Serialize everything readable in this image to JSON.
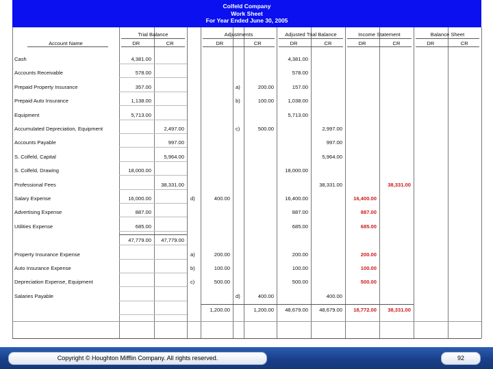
{
  "header": {
    "company": "Colfeld Company",
    "title": "Work Sheet",
    "period": "For Year Ended June 30, 2005"
  },
  "columns": {
    "account_name": "Account Name",
    "groups": [
      "Trial Balance",
      "Adjustments",
      "Adjusted Trial Balance",
      "Income Statement",
      "Balance Sheet"
    ],
    "dr": "DR",
    "cr": "CR"
  },
  "rows": [
    {
      "name": "Cash",
      "tb_dr": "4,381.00",
      "tb_cr": "",
      "adj_dr_ref": "",
      "adj_dr": "",
      "adj_cr_ref": "",
      "adj_cr": "",
      "atb_dr": "4,381.00",
      "atb_cr": "",
      "is_dr": "",
      "is_cr": ""
    },
    {
      "name": "Accounts Receivable",
      "tb_dr": "578.00",
      "tb_cr": "",
      "adj_dr_ref": "",
      "adj_dr": "",
      "adj_cr_ref": "",
      "adj_cr": "",
      "atb_dr": "578.00",
      "atb_cr": "",
      "is_dr": "",
      "is_cr": ""
    },
    {
      "name": "Prepaid Property Insurance",
      "tb_dr": "357.00",
      "tb_cr": "",
      "adj_dr_ref": "",
      "adj_dr": "",
      "adj_cr_ref": "a)",
      "adj_cr": "200.00",
      "atb_dr": "157.00",
      "atb_cr": "",
      "is_dr": "",
      "is_cr": ""
    },
    {
      "name": "Prepaid Auto Insurance",
      "tb_dr": "1,138.00",
      "tb_cr": "",
      "adj_dr_ref": "",
      "adj_dr": "",
      "adj_cr_ref": "b)",
      "adj_cr": "100.00",
      "atb_dr": "1,038.00",
      "atb_cr": "",
      "is_dr": "",
      "is_cr": ""
    },
    {
      "name": "Equipment",
      "tb_dr": "5,713.00",
      "tb_cr": "",
      "adj_dr_ref": "",
      "adj_dr": "",
      "adj_cr_ref": "",
      "adj_cr": "",
      "atb_dr": "5,713.00",
      "atb_cr": "",
      "is_dr": "",
      "is_cr": ""
    },
    {
      "name": "Accumulated Depreciation, Equipment",
      "tb_dr": "",
      "tb_cr": "2,497.00",
      "adj_dr_ref": "",
      "adj_dr": "",
      "adj_cr_ref": "c)",
      "adj_cr": "500.00",
      "atb_dr": "",
      "atb_cr": "2,997.00",
      "is_dr": "",
      "is_cr": ""
    },
    {
      "name": "Accounts Payable",
      "tb_dr": "",
      "tb_cr": "997.00",
      "adj_dr_ref": "",
      "adj_dr": "",
      "adj_cr_ref": "",
      "adj_cr": "",
      "atb_dr": "",
      "atb_cr": "997.00",
      "is_dr": "",
      "is_cr": ""
    },
    {
      "name": "S. Colfeld, Capital",
      "tb_dr": "",
      "tb_cr": "5,964.00",
      "adj_dr_ref": "",
      "adj_dr": "",
      "adj_cr_ref": "",
      "adj_cr": "",
      "atb_dr": "",
      "atb_cr": "5,964.00",
      "is_dr": "",
      "is_cr": ""
    },
    {
      "name": "S. Colfeld, Drawing",
      "tb_dr": "18,000.00",
      "tb_cr": "",
      "adj_dr_ref": "",
      "adj_dr": "",
      "adj_cr_ref": "",
      "adj_cr": "",
      "atb_dr": "18,000.00",
      "atb_cr": "",
      "is_dr": "",
      "is_cr": ""
    },
    {
      "name": "Professional Fees",
      "tb_dr": "",
      "tb_cr": "38,331.00",
      "adj_dr_ref": "",
      "adj_dr": "",
      "adj_cr_ref": "",
      "adj_cr": "",
      "atb_dr": "",
      "atb_cr": "38,331.00",
      "is_dr": "",
      "is_cr": "38,331.00"
    },
    {
      "name": "Salary Expense",
      "tb_dr": "16,000.00",
      "tb_cr": "",
      "adj_dr_ref": "d)",
      "adj_dr": "400.00",
      "adj_cr_ref": "",
      "adj_cr": "",
      "atb_dr": "16,400.00",
      "atb_cr": "",
      "is_dr": "16,400.00",
      "is_cr": ""
    },
    {
      "name": "Advertising Expense",
      "tb_dr": "887.00",
      "tb_cr": "",
      "adj_dr_ref": "",
      "adj_dr": "",
      "adj_cr_ref": "",
      "adj_cr": "",
      "atb_dr": "887.00",
      "atb_cr": "",
      "is_dr": "887.00",
      "is_cr": ""
    },
    {
      "name": "Utilities Expense",
      "tb_dr": "685.00",
      "tb_cr": "",
      "adj_dr_ref": "",
      "adj_dr": "",
      "adj_cr_ref": "",
      "adj_cr": "",
      "atb_dr": "685.00",
      "atb_cr": "",
      "is_dr": "685.00",
      "is_cr": ""
    },
    {
      "name": "",
      "tb_dr": "47,779.00",
      "tb_cr": "47,779.00",
      "adj_dr_ref": "",
      "adj_dr": "",
      "adj_cr_ref": "",
      "adj_cr": "",
      "atb_dr": "",
      "atb_cr": "",
      "is_dr": "",
      "is_cr": ""
    },
    {
      "name": "Property Insurance Expense",
      "tb_dr": "",
      "tb_cr": "",
      "adj_dr_ref": "a)",
      "adj_dr": "200.00",
      "adj_cr_ref": "",
      "adj_cr": "",
      "atb_dr": "200.00",
      "atb_cr": "",
      "is_dr": "200.00",
      "is_cr": ""
    },
    {
      "name": "Auto Insurance Expense",
      "tb_dr": "",
      "tb_cr": "",
      "adj_dr_ref": "b)",
      "adj_dr": "100.00",
      "adj_cr_ref": "",
      "adj_cr": "",
      "atb_dr": "100.00",
      "atb_cr": "",
      "is_dr": "100.00",
      "is_cr": ""
    },
    {
      "name": "Depreciation Expense, Equipment",
      "tb_dr": "",
      "tb_cr": "",
      "adj_dr_ref": "c)",
      "adj_dr": "500.00",
      "adj_cr_ref": "",
      "adj_cr": "",
      "atb_dr": "500.00",
      "atb_cr": "",
      "is_dr": "500.00",
      "is_cr": ""
    },
    {
      "name": "Salaries Payable",
      "tb_dr": "",
      "tb_cr": "",
      "adj_dr_ref": "",
      "adj_dr": "",
      "adj_cr_ref": "d)",
      "adj_cr": "400.00",
      "atb_dr": "",
      "atb_cr": "400.00",
      "is_dr": "",
      "is_cr": ""
    },
    {
      "name": "",
      "tb_dr": "",
      "tb_cr": "",
      "adj_dr_ref": "",
      "adj_dr": "1,200.00",
      "adj_cr_ref": "",
      "adj_cr": "1,200.00",
      "atb_dr": "48,679.00",
      "atb_cr": "48,679.00",
      "is_dr": "18,772.00",
      "is_cr": "38,331.00"
    }
  ],
  "footer": {
    "copyright": "Copyright © Houghton Mifflin Company. All rights reserved.",
    "page": "92"
  },
  "colors": {
    "header_bg": "#0a10f0",
    "income_text": "#cc1a1a",
    "footer_bg": "#1a3f8a"
  }
}
